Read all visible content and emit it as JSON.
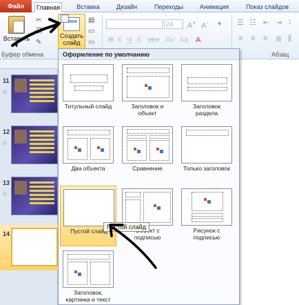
{
  "tabs": {
    "file": "Файл",
    "home": "Главная",
    "insert": "Вставка",
    "design": "Дизайн",
    "transitions": "Переходы",
    "animation": "Анимация",
    "slideshow": "Показ слайдов"
  },
  "ribbon": {
    "paste_label": "Вставить",
    "new_slide_label_1": "Создать",
    "new_slide_label_2": "слайд",
    "clipboard_group": "Буфер обмена",
    "paragraph_group": "Абзац",
    "font_size": "24"
  },
  "thumbnails": {
    "numbers": [
      "11",
      "12",
      "13",
      "14"
    ],
    "star": "☆"
  },
  "gallery": {
    "header": "Оформление по умолчанию",
    "layouts": [
      {
        "label_1": "Титульный слайд",
        "label_2": ""
      },
      {
        "label_1": "Заголовок и",
        "label_2": "объект"
      },
      {
        "label_1": "Заголовок",
        "label_2": "раздела"
      },
      {
        "label_1": "Два объекта",
        "label_2": ""
      },
      {
        "label_1": "Сравнение",
        "label_2": ""
      },
      {
        "label_1": "Только заголовок",
        "label_2": ""
      },
      {
        "label_1": "Пустой слайд",
        "label_2": ""
      },
      {
        "label_1": "Объект с",
        "label_2": "подписью"
      },
      {
        "label_1": "Рисунок с",
        "label_2": "подписью"
      },
      {
        "label_1": "Заголовок,",
        "label_2": "картинка и текст"
      }
    ]
  },
  "tooltip": "Пустой слайд",
  "colors": {
    "file_tab": "#c9402a",
    "selection": "#ffd978",
    "annotation_ink": "#000000"
  }
}
